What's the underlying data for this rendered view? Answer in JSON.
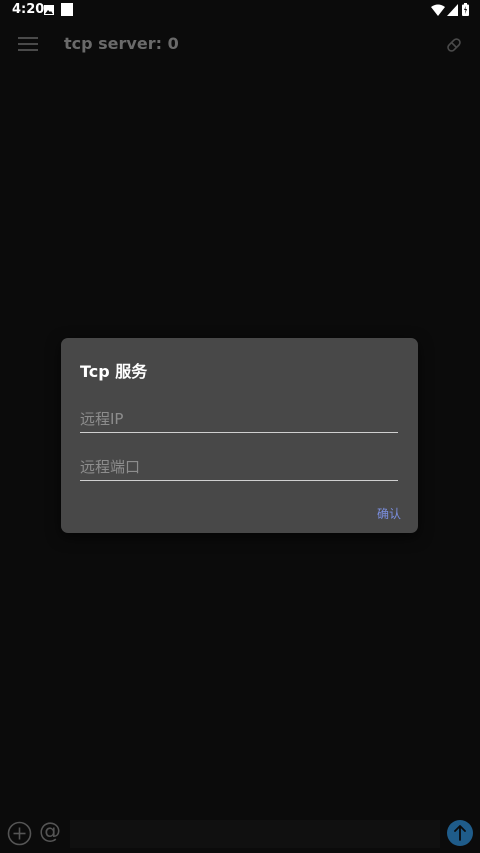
{
  "status_bar": {
    "time": "4:20",
    "icons": [
      "image-icon",
      "square-icon",
      "wifi-icon",
      "signal-icon",
      "battery-icon"
    ]
  },
  "toolbar": {
    "title": "tcp server: 0",
    "icons": [
      "menu-icon",
      "clear-icon"
    ]
  },
  "dialog": {
    "title": "Tcp 服务",
    "ip_placeholder": "远程IP",
    "ip_value": "",
    "port_placeholder": "远程端口",
    "port_value": "",
    "confirm_label": "确认"
  },
  "bottom_bar": {
    "at_label": "@",
    "message_value": "",
    "icons": [
      "add-icon",
      "send-icon"
    ]
  },
  "colors": {
    "background": "#0b0b0b",
    "dialog": "#484848",
    "accent": "#7b8fe0",
    "send": "#1f5c8a"
  }
}
